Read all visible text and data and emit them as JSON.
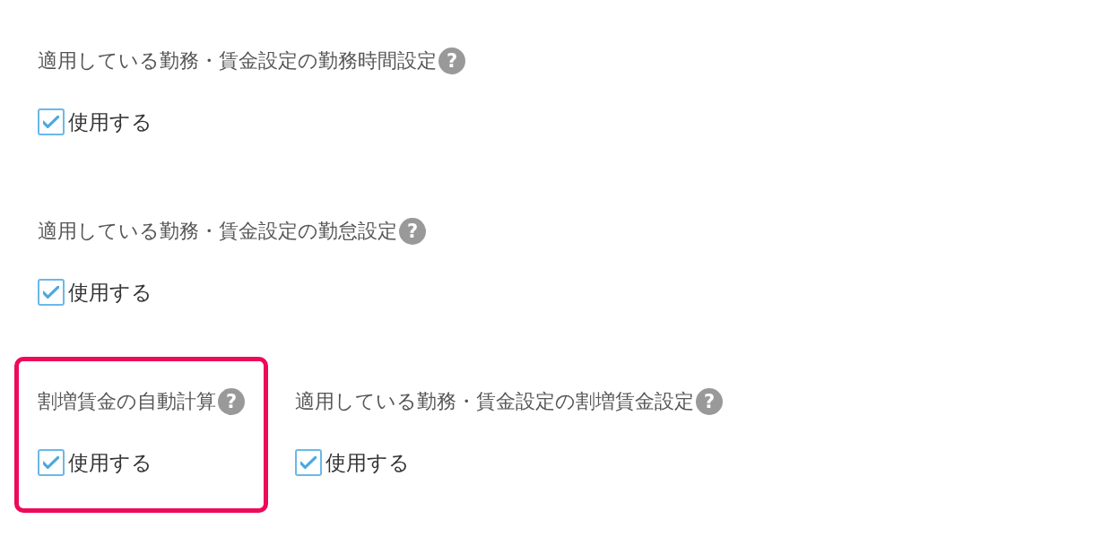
{
  "rows": [
    {
      "settings": [
        {
          "title": "適用している勤務・賃金設定の勤務時間設定",
          "help": "?",
          "option": "使用する",
          "checked": true,
          "highlighted": false
        }
      ]
    },
    {
      "settings": [
        {
          "title": "適用している勤務・賃金設定の勤怠設定",
          "help": "?",
          "option": "使用する",
          "checked": true,
          "highlighted": false
        }
      ]
    },
    {
      "settings": [
        {
          "title": "割増賃金の自動計算",
          "help": "?",
          "option": "使用する",
          "checked": true,
          "highlighted": true
        },
        {
          "title": "適用している勤務・賃金設定の割増賃金設定",
          "help": "?",
          "option": "使用する",
          "checked": true,
          "highlighted": false
        }
      ]
    }
  ]
}
